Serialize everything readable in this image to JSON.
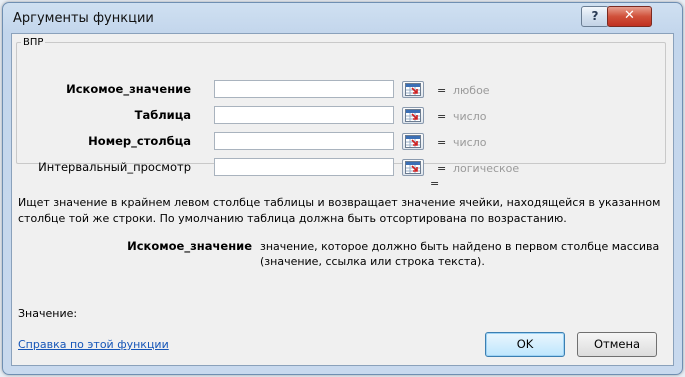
{
  "window": {
    "title": "Аргументы функции",
    "help_glyph": "?",
    "close_glyph": "✕"
  },
  "function_name": "ВПР",
  "arguments": [
    {
      "label": "Искомое_значение",
      "bold": true,
      "value": "",
      "equals": "=",
      "hint": "любое"
    },
    {
      "label": "Таблица",
      "bold": true,
      "value": "",
      "equals": "=",
      "hint": "число"
    },
    {
      "label": "Номер_столбца",
      "bold": true,
      "value": "",
      "equals": "=",
      "hint": "число"
    },
    {
      "label": "Интервальный_просмотр",
      "bold": false,
      "value": "",
      "equals": "=",
      "hint": "логическое"
    }
  ],
  "result_equals": "=",
  "description": "Ищет значение в крайнем левом столбце таблицы и возвращает значение ячейки, находящейся в указанном столбце той же строки. По умолчанию таблица должна быть отсортирована по возрастанию.",
  "argument_help": {
    "name": "Искомое_значение",
    "text": "значение, которое должно быть найдено в первом столбце массива (значение, ссылка или строка текста)."
  },
  "result_label": "Значение:",
  "help_link": "Справка по этой функции",
  "buttons": {
    "ok": "OK",
    "cancel": "Отмена"
  },
  "icons": {
    "ref_button": "collapse-dialog-icon"
  }
}
